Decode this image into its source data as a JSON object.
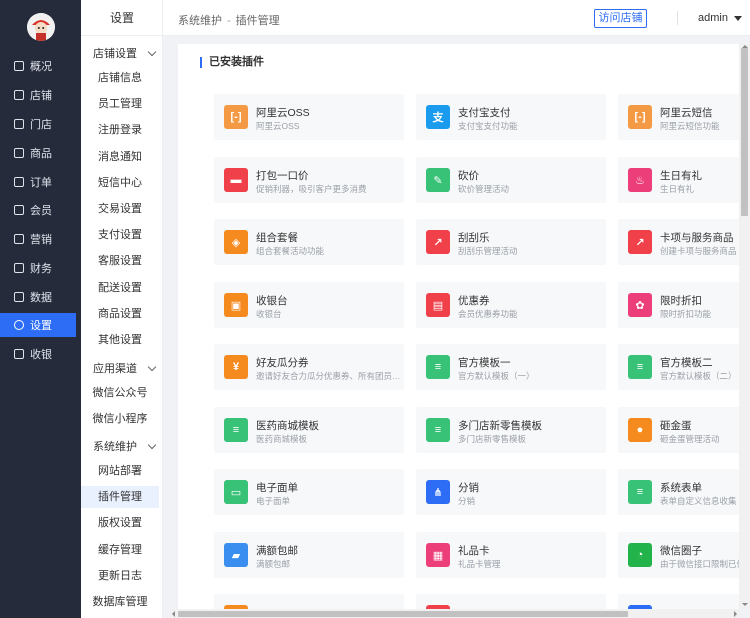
{
  "nav": {
    "items": [
      {
        "label": "概况",
        "icon": "monitor-icon"
      },
      {
        "label": "店铺",
        "icon": "shop-icon"
      },
      {
        "label": "门店",
        "icon": "store-icon"
      },
      {
        "label": "商品",
        "icon": "goods-icon"
      },
      {
        "label": "订单",
        "icon": "order-icon"
      },
      {
        "label": "会员",
        "icon": "member-icon"
      },
      {
        "label": "营销",
        "icon": "marketing-icon"
      },
      {
        "label": "财务",
        "icon": "finance-icon"
      },
      {
        "label": "数据",
        "icon": "data-icon"
      },
      {
        "label": "设置",
        "icon": "settings-icon"
      },
      {
        "label": "收银",
        "icon": "cashier-icon"
      }
    ],
    "active_index": 9
  },
  "sub": {
    "title": "设置",
    "groups": [
      {
        "label": "店铺设置",
        "items": [
          "店铺信息",
          "员工管理",
          "注册登录",
          "消息通知",
          "短信中心",
          "交易设置",
          "支付设置",
          "客服设置",
          "配送设置",
          "商品设置",
          "其他设置"
        ]
      },
      {
        "label": "应用渠道",
        "items": [
          "微信公众号",
          "微信小程序"
        ]
      },
      {
        "label": "系统维护",
        "items": [
          "网站部署",
          "插件管理",
          "版权设置",
          "缓存管理",
          "更新日志",
          "数据库管理"
        ]
      }
    ],
    "active_item": "插件管理"
  },
  "header": {
    "breadcrumb": [
      "系统维护",
      "插件管理"
    ],
    "breadcrumb_sep": "-",
    "visit_label": "访问店铺",
    "user": "admin"
  },
  "main": {
    "section_title": "已安装插件",
    "plugins": [
      {
        "name": "阿里云OSS",
        "desc": "阿里云OSS",
        "color": "#f59a44",
        "icon": "bracket-icon"
      },
      {
        "name": "支付宝支付",
        "desc": "支付宝支付功能",
        "color": "#1a9bee",
        "icon": "alipay-icon"
      },
      {
        "name": "阿里云短信",
        "desc": "阿里云短信功能",
        "color": "#f59a44",
        "icon": "bracket-icon"
      },
      {
        "name": "打包一口价",
        "desc": "促销利器，吸引客户更多消费",
        "color": "#f0414a",
        "icon": "box-icon"
      },
      {
        "name": "砍价",
        "desc": "砍价管理活动",
        "color": "#38c277",
        "icon": "tag-icon"
      },
      {
        "name": "生日有礼",
        "desc": "生日有礼",
        "color": "#ec3f7a",
        "icon": "cake-icon"
      },
      {
        "name": "组合套餐",
        "desc": "组合套餐活动功能",
        "color": "#f58a1f",
        "icon": "layers-icon"
      },
      {
        "name": "刮刮乐",
        "desc": "刮刮乐管理活动",
        "color": "#f0414a",
        "icon": "chart-icon"
      },
      {
        "name": "卡项与服务商品",
        "desc": "创建卡项与服务商品",
        "color": "#f0414a",
        "icon": "chart-icon"
      },
      {
        "name": "收银台",
        "desc": "收银台",
        "color": "#f58a1f",
        "icon": "cashier-icon"
      },
      {
        "name": "优惠券",
        "desc": "会员优惠券功能",
        "color": "#f0414a",
        "icon": "coupon-icon"
      },
      {
        "name": "限时折扣",
        "desc": "限时折扣功能",
        "color": "#ec3f7a",
        "icon": "flower-icon"
      },
      {
        "name": "好友瓜分券",
        "desc": "邀请好友合力瓜分优惠券、所有团员都有奖励",
        "color": "#f58a1f",
        "icon": "yen-icon"
      },
      {
        "name": "官方模板一",
        "desc": "官方默认模板（一）",
        "color": "#38c277",
        "icon": "doc-icon"
      },
      {
        "name": "官方模板二",
        "desc": "官方默认模板（二）",
        "color": "#38c277",
        "icon": "doc-icon"
      },
      {
        "name": "医药商城模板",
        "desc": "医药商城模板",
        "color": "#38c277",
        "icon": "doc-icon"
      },
      {
        "name": "多门店新零售模板",
        "desc": "多门店新零售模板",
        "color": "#38c277",
        "icon": "doc-icon"
      },
      {
        "name": "砸金蛋",
        "desc": "砸金蛋管理活动",
        "color": "#f58a1f",
        "icon": "egg-icon"
      },
      {
        "name": "电子面单",
        "desc": "电子面单",
        "color": "#38c277",
        "icon": "waybill-icon"
      },
      {
        "name": "分销",
        "desc": "分销",
        "color": "#2d6df6",
        "icon": "share-icon"
      },
      {
        "name": "系统表单",
        "desc": "表单自定义信息收集",
        "color": "#38c277",
        "icon": "doc-icon"
      },
      {
        "name": "满额包邮",
        "desc": "满额包邮",
        "color": "#3a8ef0",
        "icon": "truck-icon"
      },
      {
        "name": "礼品卡",
        "desc": "礼品卡管理",
        "color": "#ec3f7a",
        "icon": "gift-icon"
      },
      {
        "name": "微信圈子",
        "desc": "由于微信接口限制已停止服务",
        "color": "#22b34a",
        "icon": "circle-icon"
      }
    ],
    "partial_row_colors": [
      "#f58a1f",
      "#f0414a",
      "#2d6df6"
    ]
  }
}
